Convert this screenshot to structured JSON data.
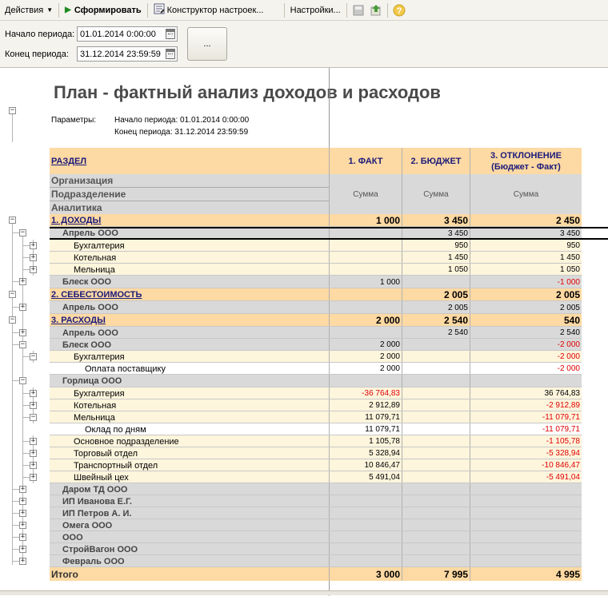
{
  "toolbar": {
    "actions": "Действия",
    "generate": "Сформировать",
    "constructor": "Конструктор настроек...",
    "settings": "Настройки..."
  },
  "params": {
    "start_label": "Начало периода:",
    "start_value": "01.01.2014 0:00:00",
    "end_label": "Конец периода:",
    "end_value": "31.12.2014 23:59:59",
    "dots": "..."
  },
  "report": {
    "title": "План - фактный анализ доходов и расходов",
    "params_label": "Параметры:",
    "params_start": "Начало периода: 01.01.2014 0:00:00",
    "params_end": "Конец периода: 31.12.2014 23:59:59",
    "headers": {
      "section": "РАЗДЕЛ",
      "fact": "1. ФАКТ",
      "budget": "2. БЮДЖЕТ",
      "dev1": "3. ОТКЛОНЕНИЕ",
      "dev2": "(Бюджет - Факт)",
      "org": "Организация",
      "dept": "Подразделение",
      "anal": "Аналитика",
      "sum": "Сумма"
    },
    "rows": [
      {
        "name": "1. ДОХОДЫ",
        "fact": "1 000",
        "budget": "3 450",
        "dev": "2 450"
      },
      {
        "name": "Апрель ООО",
        "fact": "",
        "budget": "3 450",
        "dev": "3 450"
      },
      {
        "name": "Бухгалтерия",
        "fact": "",
        "budget": "950",
        "dev": "950"
      },
      {
        "name": "Котельная",
        "fact": "",
        "budget": "1 450",
        "dev": "1 450"
      },
      {
        "name": "Мельница",
        "fact": "",
        "budget": "1 050",
        "dev": "1 050"
      },
      {
        "name": "Блеск ООО",
        "fact": "1 000",
        "budget": "",
        "dev": "-1 000"
      },
      {
        "name": "2. СЕБЕСТОИМОСТЬ",
        "fact": "",
        "budget": "2 005",
        "dev": "2 005"
      },
      {
        "name": "Апрель ООО",
        "fact": "",
        "budget": "2 005",
        "dev": "2 005"
      },
      {
        "name": "3. РАСХОДЫ",
        "fact": "2 000",
        "budget": "2 540",
        "dev": "540"
      },
      {
        "name": "Апрель ООО",
        "fact": "",
        "budget": "2 540",
        "dev": "2 540"
      },
      {
        "name": "Блеск ООО",
        "fact": "2 000",
        "budget": "",
        "dev": "-2 000"
      },
      {
        "name": "Бухгалтерия",
        "fact": "2 000",
        "budget": "",
        "dev": "-2 000"
      },
      {
        "name": "Оплата поставщику",
        "fact": "2 000",
        "budget": "",
        "dev": "-2 000"
      },
      {
        "name": "Горлица ООО",
        "fact": "",
        "budget": "",
        "dev": ""
      },
      {
        "name": "Бухгалтерия",
        "fact": "-36 764,83",
        "budget": "",
        "dev": "36 764,83"
      },
      {
        "name": "Котельная",
        "fact": "2 912,89",
        "budget": "",
        "dev": "-2 912,89"
      },
      {
        "name": "Мельница",
        "fact": "11 079,71",
        "budget": "",
        "dev": "-11 079,71"
      },
      {
        "name": "Оклад по дням",
        "fact": "11 079,71",
        "budget": "",
        "dev": "-11 079,71"
      },
      {
        "name": "Основное подразделение",
        "fact": "1 105,78",
        "budget": "",
        "dev": "-1 105,78"
      },
      {
        "name": "Торговый отдел",
        "fact": "5 328,94",
        "budget": "",
        "dev": "-5 328,94"
      },
      {
        "name": "Транспортный отдел",
        "fact": "10 846,47",
        "budget": "",
        "dev": "-10 846,47"
      },
      {
        "name": "Швейный цех",
        "fact": "5 491,04",
        "budget": "",
        "dev": "-5 491,04"
      },
      {
        "name": "Даром ТД ООО",
        "fact": "",
        "budget": "",
        "dev": ""
      },
      {
        "name": "ИП Иванова Е.Г.",
        "fact": "",
        "budget": "",
        "dev": ""
      },
      {
        "name": "ИП Петров А. И.",
        "fact": "",
        "budget": "",
        "dev": ""
      },
      {
        "name": "Омега ООО",
        "fact": "",
        "budget": "",
        "dev": ""
      },
      {
        "name": "ООО",
        "fact": "",
        "budget": "",
        "dev": ""
      },
      {
        "name": "СтройВагон ООО",
        "fact": "",
        "budget": "",
        "dev": ""
      },
      {
        "name": "Февраль ООО",
        "fact": "",
        "budget": "",
        "dev": ""
      }
    ],
    "total": {
      "name": "Итого",
      "fact": "3 000",
      "budget": "7 995",
      "dev": "4 995"
    }
  },
  "colors": {
    "header": "#fdd9a3",
    "group": "#d9d9d9",
    "item": "#fdf5dc",
    "negative": "#e00000",
    "title": "#4a4a4a"
  }
}
